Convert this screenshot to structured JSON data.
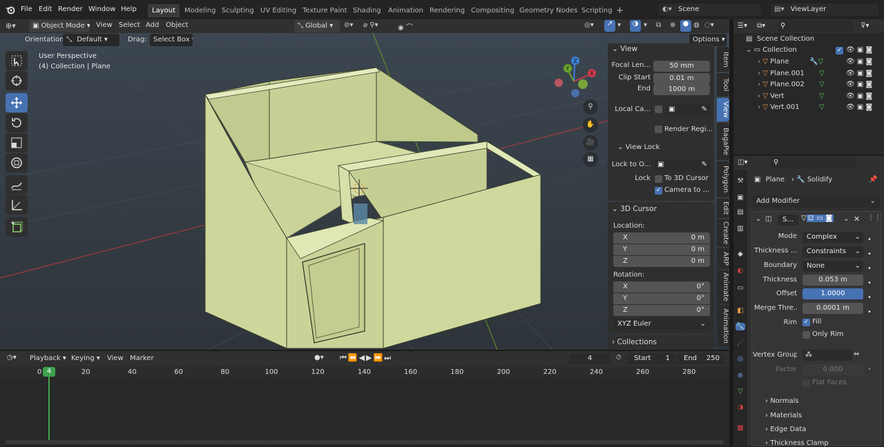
{
  "topbar": {
    "menus": [
      "File",
      "Edit",
      "Render",
      "Window",
      "Help"
    ],
    "workspaces": [
      "Layout",
      "Modeling",
      "Sculpting",
      "UV Editing",
      "Texture Paint",
      "Shading",
      "Animation",
      "Rendering",
      "Compositing",
      "Geometry Nodes",
      "Scripting"
    ],
    "active_workspace": "Layout",
    "add_tab": "+",
    "scene": "Scene",
    "view_layer": "ViewLayer"
  },
  "viewport_header": {
    "mode": "Object Mode",
    "menus": [
      "View",
      "Select",
      "Add",
      "Object"
    ],
    "transform_orientation": "Global"
  },
  "tool_settings": {
    "orientation_label": "Orientation:",
    "orientation_value": "Default",
    "drag_label": "Drag:",
    "drag_value": "Select Box",
    "options": "Options"
  },
  "viewport": {
    "perspective": "User Perspective",
    "collection_info": "(4) Collection | Plane",
    "gizmo": {
      "x": "X",
      "y": "Y",
      "z": "Z"
    }
  },
  "npanel": {
    "tabs": [
      "Item",
      "Tool",
      "View",
      "BagaPie",
      "Polygon",
      "Edit",
      "Create",
      "ARP",
      "Animate",
      "Animation"
    ],
    "active_tab": "View",
    "view": {
      "header": "View",
      "focal_label": "Focal Len...",
      "focal_value": "50 mm",
      "clip_start_label": "Clip Start",
      "clip_start_value": "0.01 m",
      "end_label": "End",
      "end_value": "1000 m",
      "local_camera_label": "Local Ca...",
      "render_region_label": "Render Regi..."
    },
    "view_lock": {
      "header": "View Lock",
      "lock_to_label": "Lock to O...",
      "lock_label": "Lock",
      "to_cursor_label": "To 3D Cursor",
      "camera_to_label": "Camera to ..."
    },
    "cursor": {
      "header": "3D Cursor",
      "location_label": "Location:",
      "loc": [
        {
          "axis": "X",
          "value": "0 m"
        },
        {
          "axis": "Y",
          "value": "0 m"
        },
        {
          "axis": "Z",
          "value": "0 m"
        }
      ],
      "rotation_label": "Rotation:",
      "rot": [
        {
          "axis": "X",
          "value": "0°"
        },
        {
          "axis": "Y",
          "value": "0°"
        },
        {
          "axis": "Z",
          "value": "0°"
        }
      ],
      "rotation_mode": "XYZ Euler"
    },
    "collections_header": "Collections"
  },
  "timeline": {
    "menus": [
      "Playback",
      "Keying",
      "View",
      "Marker"
    ],
    "current_frame": "4",
    "start_label": "Start",
    "start_value": "1",
    "end_label": "End",
    "end_value": "250",
    "ruler": [
      "0",
      "20",
      "40",
      "60",
      "80",
      "100",
      "120",
      "140",
      "160",
      "180",
      "200",
      "220",
      "240",
      "260",
      "280"
    ]
  },
  "outliner": {
    "scene_collection": "Scene Collection",
    "collection": "Collection",
    "items": [
      "Plane",
      "Plane.001",
      "Plane.002",
      "Vert",
      "Vert.001"
    ]
  },
  "properties": {
    "object_name": "Plane",
    "modifier_crumb": "Solidify",
    "add_modifier": "Add Modifier",
    "modifier_short_name": "S...",
    "mode_label": "Mode",
    "mode_value": "Complex",
    "thickness_mode_label": "Thickness ...",
    "thickness_mode_value": "Constraints",
    "boundary_label": "Boundary",
    "boundary_value": "None",
    "thickness_label": "Thickness",
    "thickness_value": "0.053 m",
    "offset_label": "Offset",
    "offset_value": "1.0000",
    "merge_label": "Merge Thre...",
    "merge_value": "0.0001 m",
    "rim_label": "Rim",
    "fill_label": "Fill",
    "only_rim_label": "Only Rim",
    "vertex_group_label": "Vertex Group",
    "factor_label": "Factor",
    "factor_value": "0.000",
    "flat_faces_label": "Flat Faces",
    "subpanels": [
      "Normals",
      "Materials",
      "Edge Data",
      "Thickness Clamp"
    ]
  },
  "colors": {
    "accent": "#4772b3",
    "mesh_face": "#d7e0a8",
    "x_axis": "#a33c3c",
    "y_axis": "#5c8a2e",
    "playhead": "#3fa34d"
  }
}
